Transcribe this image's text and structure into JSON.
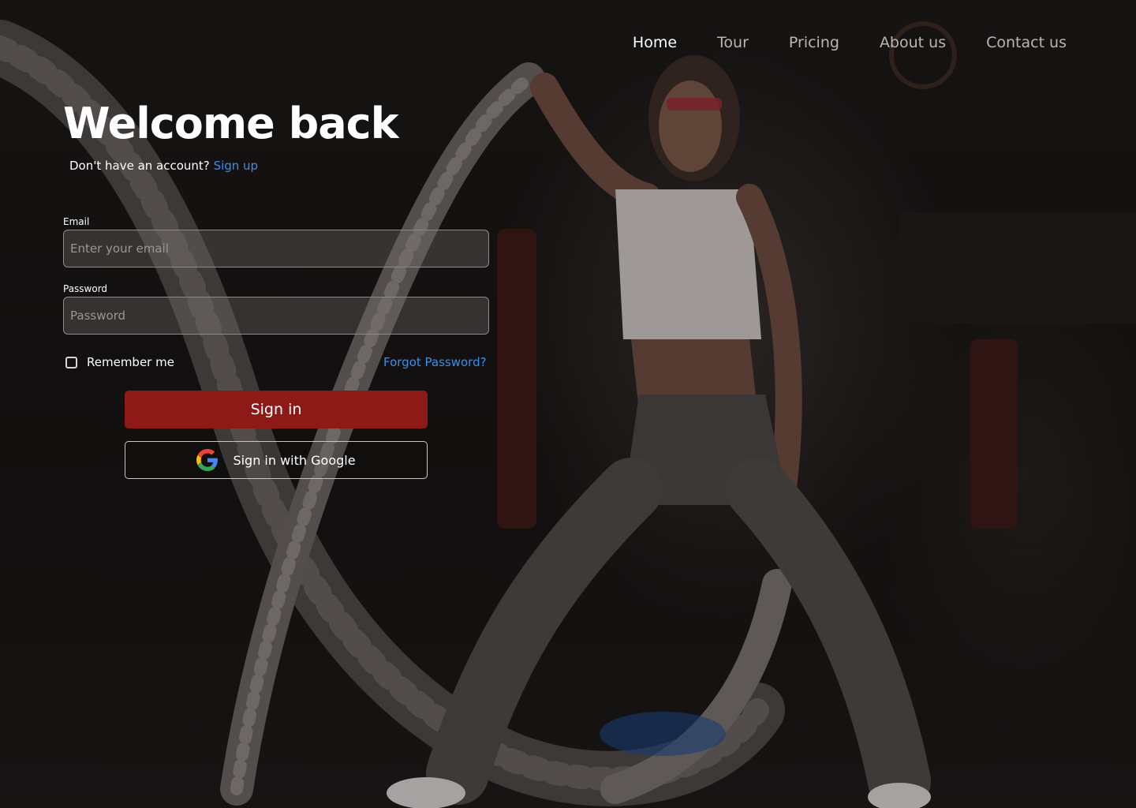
{
  "nav": {
    "items": [
      {
        "label": "Home",
        "active": true
      },
      {
        "label": "Tour",
        "active": false
      },
      {
        "label": "Pricing",
        "active": false
      },
      {
        "label": "About us",
        "active": false
      },
      {
        "label": "Contact us",
        "active": false
      }
    ]
  },
  "login": {
    "title": "Welcome back",
    "signup_prompt": "Don't have an account?",
    "signup_link": "Sign up",
    "email_label": "Email",
    "email_placeholder": "Enter your email",
    "email_value": "",
    "password_label": "Password",
    "password_placeholder": "Password",
    "password_value": "",
    "remember_label": "Remember me",
    "remember_checked": false,
    "forgot_link": "Forgot Password?",
    "signin_button": "Sign in",
    "google_button": "Sign in with Google"
  },
  "colors": {
    "accent_button": "#8d1a17",
    "link": "#3b8fe6",
    "background": "#161414"
  },
  "background_image": "gym-battle-ropes-photo"
}
